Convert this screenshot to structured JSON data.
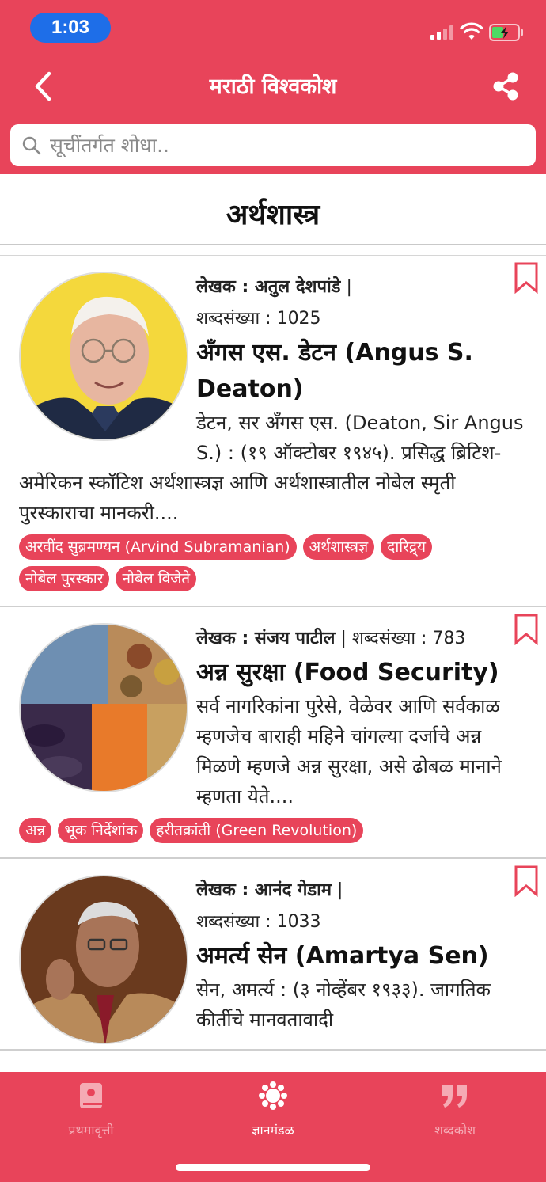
{
  "status": {
    "time": "1:03"
  },
  "nav": {
    "title": "मराठी विश्वकोश"
  },
  "search": {
    "placeholder": "सूचींतर्गत शोधा.."
  },
  "section": {
    "title": "अर्थशास्त्र"
  },
  "articles": [
    {
      "author_label": "लेखक : अतुल देशपांडे",
      "separator": "|",
      "word_count": "शब्दसंख्या : 1025",
      "title": "अँगस एस. डेटन (Angus S. Deaton)",
      "excerpt": "डेटन, सर अँगस एस. (Deaton, Sir Angus S.) : (१९ ऑक्टोबर १९४५). प्रसिद्ध ब्रिटिश-अमेरिकन स्कॉटिश अर्थशास्त्रज्ञ आणि अर्थशास्त्रातील नोबेल स्मृती पुरस्काराचा मानकरी....",
      "tags": [
        "अरवींद सुब्रमण्यन (Arvind Subramanian)",
        "अर्थशास्त्रज्ञ",
        "दारिद्र्य",
        "नोबेल पुरस्कार",
        "नोबेल विजेते"
      ]
    },
    {
      "author_label": "लेखक : संजय पाटील",
      "separator": "|",
      "word_count": "शब्दसंख्या : 783",
      "title": "अन्न सुरक्षा (Food Security)",
      "excerpt": "सर्व नागरिकांना पुरेसे, वेळेवर आणि सर्वकाळ म्हणजेच बाराही महिने चांगल्या दर्जाचे अन्न मिळणे म्हणजे अन्न सुरक्षा, असे ढोबळ मानाने म्हणता येते....",
      "tags": [
        "अन्न",
        "भूक निर्देशांक",
        "हरीतक्रांती (Green Revolution)"
      ]
    },
    {
      "author_label": "लेखक : आनंद गेडाम",
      "separator": "|",
      "word_count": "शब्दसंख्या : 1033",
      "title": "अमर्त्य सेन (Amartya Sen)",
      "excerpt": "सेन, अमर्त्य : (३ नोव्हेंबर १९३३). जागतिक कीर्तीचे मानवतावादी",
      "tags": []
    }
  ],
  "tabs": [
    {
      "label": "प्रथमावृत्ती",
      "icon": "book-icon"
    },
    {
      "label": "ज्ञानमंडळ",
      "icon": "flower-icon"
    },
    {
      "label": "शब्दकोश",
      "icon": "quote-icon"
    }
  ],
  "colors": {
    "accent": "#e8445a",
    "time_pill": "#1e6ee8"
  }
}
